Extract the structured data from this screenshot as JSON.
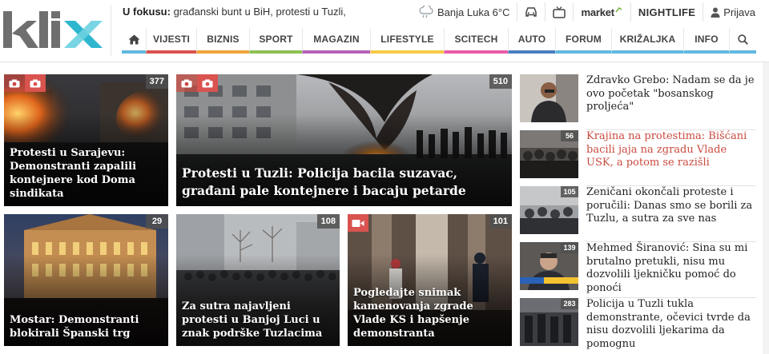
{
  "brand": {
    "logo_text": "klix",
    "colors": {
      "logo_grey": "#6f6f6f",
      "logo_cross_a": "#2fb6cf",
      "logo_cross_b": "#6ad0e0"
    }
  },
  "header": {
    "focus_label": "U fokusu:",
    "focus_text": "građanski bunt u BiH, protesti u Tuzli,",
    "weather": {
      "icon": "cloud-rain-icon",
      "text": "Banja Luka 6°C"
    },
    "links": [
      {
        "icon": "car-icon",
        "label": ""
      },
      {
        "icon": "tv-icon",
        "label": ""
      },
      {
        "label": "market",
        "icon": "market-arrow-icon"
      },
      {
        "label": "NIGHTLIFE"
      },
      {
        "icon": "user-icon",
        "label": "Prijava"
      }
    ]
  },
  "nav": {
    "home_icon": "home-icon",
    "items": [
      {
        "label": "VIJESTI",
        "color": "#d9534f"
      },
      {
        "label": "BIZNIS",
        "color": "#f0a33a"
      },
      {
        "label": "SPORT",
        "color": "#8cc152"
      },
      {
        "label": "MAGAZIN",
        "color": "#b562b8"
      },
      {
        "label": "LIFESTYLE",
        "color": "#f6c945"
      },
      {
        "label": "SCITECH",
        "color": "#e95aa6"
      },
      {
        "label": "AUTO",
        "color": "#4a7fc1"
      },
      {
        "label": "FORUM",
        "color": "#61b9e1"
      },
      {
        "label": "KRIŽALJKA",
        "color": "#61b9e1"
      },
      {
        "label": "INFO",
        "color": "#61b9e1"
      }
    ],
    "search_icon": "search-icon"
  },
  "tiles": [
    {
      "count": "377",
      "media": [
        "camera-icon"
      ],
      "title": "Protesti u Sarajevu: Demonstranti zapalili kontejnere kod Doma sindikata"
    },
    {
      "count": "510",
      "media": [
        "camera-icon"
      ],
      "title": "Protesti u Tuzli: Policija bacila suzavac, građani pale kontejnere i bacaju petarde"
    },
    {
      "count": "29",
      "media": [],
      "title": "Mostar: Demonstranti blokirali Španski trg"
    },
    {
      "count": "108",
      "media": [],
      "title": "Za sutra najavljeni protesti u Banjoj Luci u znak podrške Tuzlacima"
    },
    {
      "count": "101",
      "media": [
        "video-icon"
      ],
      "title": "Pogledajte snimak kamenovanja zgrade Vlade KS i hapšenje demonstranta"
    }
  ],
  "sidebar": [
    {
      "count": "",
      "title": "Zdravko Grebo: Nadam se da je ovo početak \"bosanskog proljeća\"",
      "highlight": false
    },
    {
      "count": "56",
      "title": "Krajina na protestima: Bišćani bacili jaja na zgradu Vlade USK, a potom se razišli",
      "highlight": true
    },
    {
      "count": "105",
      "title": "Zeničani okončali proteste i poručili: Danas smo se borili za Tuzlu, a sutra za sve nas",
      "highlight": false
    },
    {
      "count": "139",
      "title": "Mehmed Širanović: Sina su mi brutalno pretukli, nisu mu dozvolili ljekničku pomoć do ponoći",
      "highlight": false
    },
    {
      "count": "283",
      "title": "Policija u Tuzli tukla demonstrante, očevici tvrde da nisu dozvolili ljekarima da pomognu",
      "highlight": false
    }
  ],
  "colors": {
    "media_badge": "#d9534f",
    "count_badge": "#555555",
    "highlight_text": "#c94a3f"
  }
}
